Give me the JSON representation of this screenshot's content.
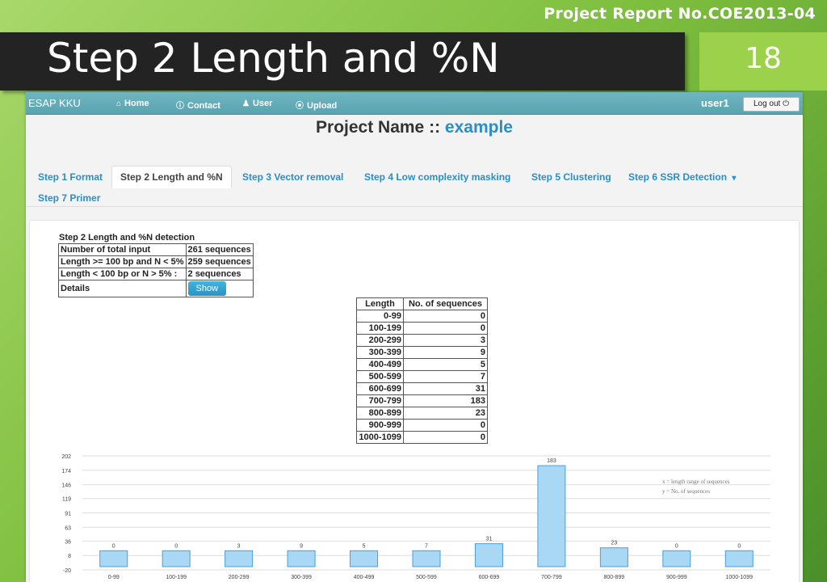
{
  "slide": {
    "report_no": "Project Report No.COE2013-04",
    "title": "Step 2 Length and %N",
    "page_number": "18"
  },
  "navbar": {
    "brand": "ESAP KKU",
    "links": [
      {
        "label": "Home",
        "icon": "home-icon",
        "glyph": "⌂"
      },
      {
        "label": "Contact",
        "icon": "info-icon",
        "glyph": "ⓘ"
      },
      {
        "label": "User",
        "icon": "user-icon",
        "glyph": "♟"
      },
      {
        "label": "Upload",
        "icon": "upload-icon",
        "glyph": "⦿"
      }
    ],
    "user": "user1",
    "logout_label": "Log out",
    "logout_icon": "power-icon",
    "logout_glyph": "⏻"
  },
  "project": {
    "prefix": "Project Name :: ",
    "name": "example"
  },
  "tabs": [
    {
      "label": "Step 1 Format",
      "active": false
    },
    {
      "label": "Step 2 Length and %N",
      "active": true
    },
    {
      "label": "Step 3 Vector removal",
      "active": false
    },
    {
      "label": "Step 4 Low complexity masking",
      "active": false
    },
    {
      "label": "Step 5 Clustering",
      "active": false
    },
    {
      "label": "Step 6 SSR Detection",
      "active": false,
      "dropdown": true,
      "caret": "▾"
    },
    {
      "label": "Step 7 Primer",
      "active": false
    }
  ],
  "summary": {
    "title": "Step 2 Length and %N detection",
    "rows": [
      {
        "label": "Number of total input",
        "value": "261 sequences"
      },
      {
        "label": "Length >= 100 bp and N < 5%",
        "value": "259 sequences"
      },
      {
        "label": "Length < 100 bp or N > 5% :",
        "value": "2 sequences"
      },
      {
        "label": "Details",
        "value": ""
      }
    ],
    "show_button": "Show"
  },
  "distribution": {
    "headers": [
      "Length",
      "No. of sequences"
    ],
    "rows": [
      [
        "0-99",
        "0"
      ],
      [
        "100-199",
        "0"
      ],
      [
        "200-299",
        "3"
      ],
      [
        "300-399",
        "9"
      ],
      [
        "400-499",
        "5"
      ],
      [
        "500-599",
        "7"
      ],
      [
        "600-699",
        "31"
      ],
      [
        "700-799",
        "183"
      ],
      [
        "800-899",
        "23"
      ],
      [
        "900-999",
        "0"
      ],
      [
        "1000-1099",
        "0"
      ]
    ]
  },
  "chart_data": {
    "type": "bar",
    "categories": [
      "0-99",
      "100-199",
      "200-299",
      "300-399",
      "400-499",
      "500-599",
      "600-699",
      "700-799",
      "800-899",
      "900-999",
      "1000-1099"
    ],
    "values": [
      0,
      0,
      3,
      9,
      5,
      7,
      31,
      183,
      23,
      0,
      0
    ],
    "ytick_labels": [
      "-20",
      "8",
      "36",
      "63",
      "91",
      "119",
      "146",
      "174",
      "202"
    ],
    "ylim": [
      -20,
      202
    ],
    "grid": true,
    "legend_position": "top-right",
    "annotations": [
      "x = length range of sequences",
      "y = No. of sequences"
    ],
    "colors": {
      "bar_fill": "#a9d8f5",
      "bar_stroke": "#4a9fd6"
    }
  },
  "colors": {
    "accent": "#2a8ec7",
    "navbar": "#5aa3b0",
    "slide_green": "#9bd14b"
  }
}
